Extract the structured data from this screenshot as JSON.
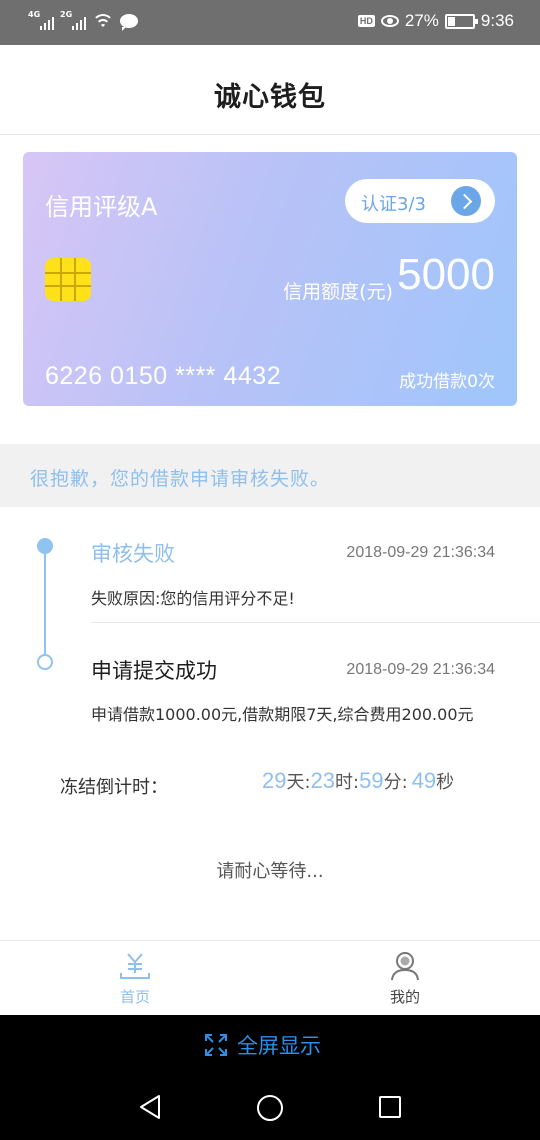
{
  "status_bar": {
    "signal_1_tag": "4G",
    "signal_2_tag": "2G",
    "hd_badge": "HD",
    "battery_percent": "27%",
    "battery_level": 0.27,
    "time": "9:36",
    "icons": [
      "signal-icon",
      "wifi-icon",
      "message-icon",
      "eye-icon",
      "battery-icon"
    ]
  },
  "header": {
    "title": "诚心钱包"
  },
  "card": {
    "rating": "信用评级A",
    "cert_label": "认证3/3",
    "limit_label": "信用额度(元)",
    "limit_value": "5000",
    "card_number": "6226 0150 **** 4432",
    "loan_count": "成功借款0次",
    "colors": {
      "gradient_start": "#d7c6f5",
      "gradient_end": "#9fc6fb",
      "chip": "#ffe11a",
      "accent": "#6aa6e8"
    }
  },
  "notice": {
    "text": "很抱歉，您的借款申请审核失败。"
  },
  "timeline": [
    {
      "title": "审核失败",
      "time": "2018-09-29 21:36:34",
      "desc": "失败原因:您的信用评分不足!"
    },
    {
      "title": "申请提交成功",
      "time": "2018-09-29 21:36:34",
      "desc": "申请借款1000.00元,借款期限7天,综合费用200.00元"
    }
  ],
  "countdown": {
    "label": "冻结倒计时：",
    "days": "29",
    "days_unit": "天:",
    "hours": "23",
    "hours_unit": "时:",
    "minutes": "59",
    "minutes_unit": "分:",
    "seconds": "49",
    "seconds_unit": "秒"
  },
  "wait_text": "请耐心等待...",
  "tabs": [
    {
      "label": "首页",
      "icon": "yen-icon",
      "active": true
    },
    {
      "label": "我的",
      "icon": "user-icon",
      "active": false
    }
  ],
  "fullscreen": {
    "label": "全屏显示",
    "icon": "expand-icon"
  },
  "nav": {
    "icons": [
      "back-icon",
      "home-icon",
      "recent-apps-icon"
    ]
  },
  "accent_color": "#8fbfec"
}
